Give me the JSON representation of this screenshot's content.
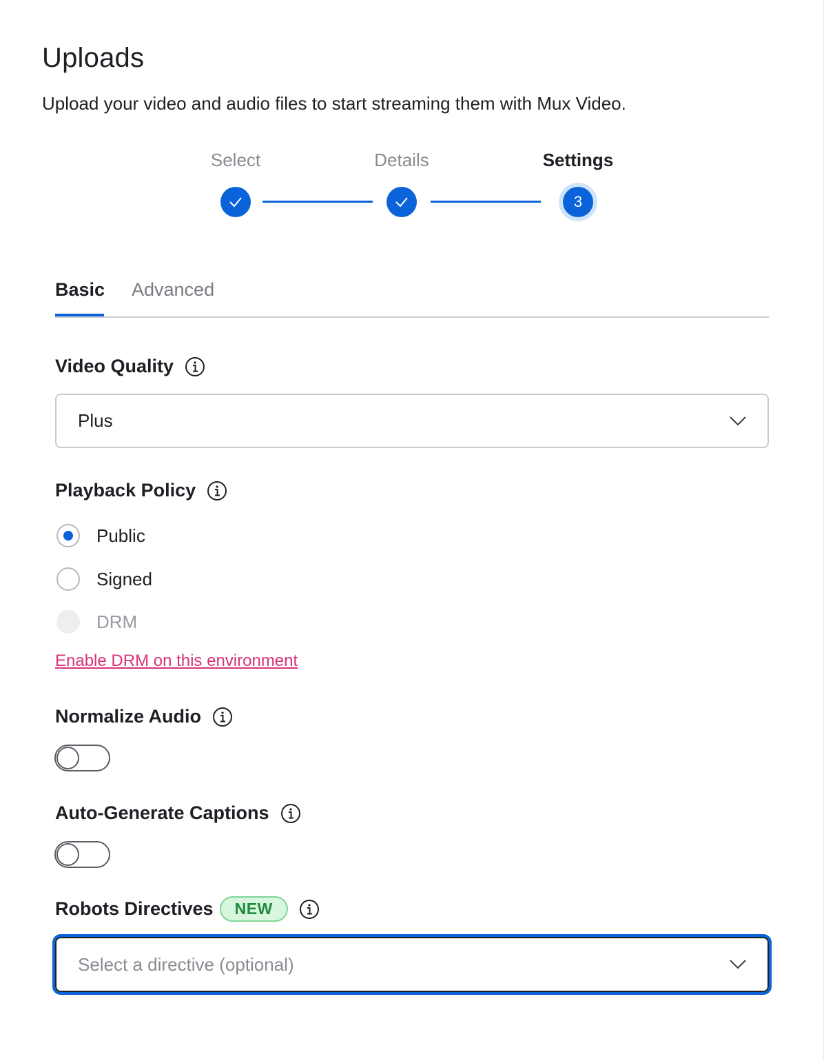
{
  "header": {
    "title": "Uploads",
    "subtitle": "Upload your video and audio files to start streaming them with Mux Video."
  },
  "stepper": {
    "steps": [
      {
        "label": "Select",
        "state": "complete"
      },
      {
        "label": "Details",
        "state": "complete"
      },
      {
        "label": "Settings",
        "state": "current",
        "number": "3"
      }
    ]
  },
  "tabs": {
    "items": [
      {
        "label": "Basic",
        "active": true
      },
      {
        "label": "Advanced",
        "active": false
      }
    ]
  },
  "video_quality": {
    "label": "Video Quality",
    "value": "Plus"
  },
  "playback_policy": {
    "label": "Playback Policy",
    "options": [
      {
        "label": "Public",
        "checked": true,
        "disabled": false
      },
      {
        "label": "Signed",
        "checked": false,
        "disabled": false
      },
      {
        "label": "DRM",
        "checked": false,
        "disabled": true
      }
    ],
    "drm_link": "Enable DRM on this environment"
  },
  "normalize_audio": {
    "label": "Normalize Audio",
    "enabled": false
  },
  "auto_captions": {
    "label": "Auto-Generate Captions",
    "enabled": false
  },
  "robots_directives": {
    "label": "Robots Directives",
    "badge": "NEW",
    "placeholder": "Select a directive (optional)"
  },
  "colors": {
    "accent": "#0b63d9",
    "link": "#d6337b",
    "badge_bg": "#d8f5de",
    "badge_text": "#1f8a3a"
  },
  "icons": {
    "check": "check-icon",
    "info": "info-icon",
    "chevron": "chevron-down-icon"
  }
}
